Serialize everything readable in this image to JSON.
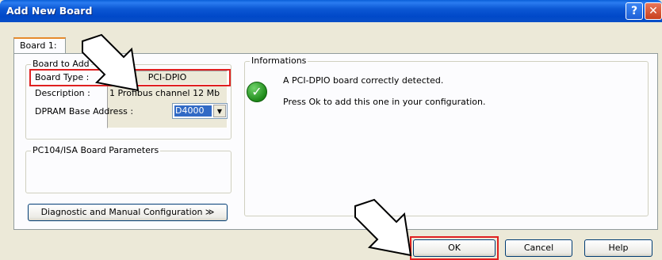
{
  "window": {
    "title": "Add New Board",
    "help_glyph": "?",
    "close_glyph": "✕"
  },
  "tab": {
    "label": "Board 1:"
  },
  "board_to_add": {
    "group_title": "Board to Add",
    "board_type_label": "Board Type :",
    "board_type_value": "PCI-DPIO",
    "description_label": "Description :",
    "description_value": "1 Profibus channel 12 Mb"
  },
  "pc104": {
    "group_title": "PC104/ISA Board Parameters",
    "dpram_label": "DPRAM Base Address :",
    "dpram_value": "D4000"
  },
  "diag_button": {
    "label": "Diagnostic and Manual Configuration ≫"
  },
  "informations": {
    "group_title": "Informations",
    "line1": "A PCI-DPIO board correctly detected.",
    "line2": "Press Ok to add this one in your configuration."
  },
  "footer": {
    "ok_label": "OK",
    "cancel_label": "Cancel",
    "help_label": "Help"
  },
  "colors": {
    "title_bar": "#0048c8",
    "highlight": "#e02020",
    "ok_icon": "#1f8a1a"
  },
  "icons": {
    "info_icon": "check-circle-icon",
    "annotation_1": "arrow-pointer-icon",
    "annotation_2": "arrow-pointer-icon"
  }
}
